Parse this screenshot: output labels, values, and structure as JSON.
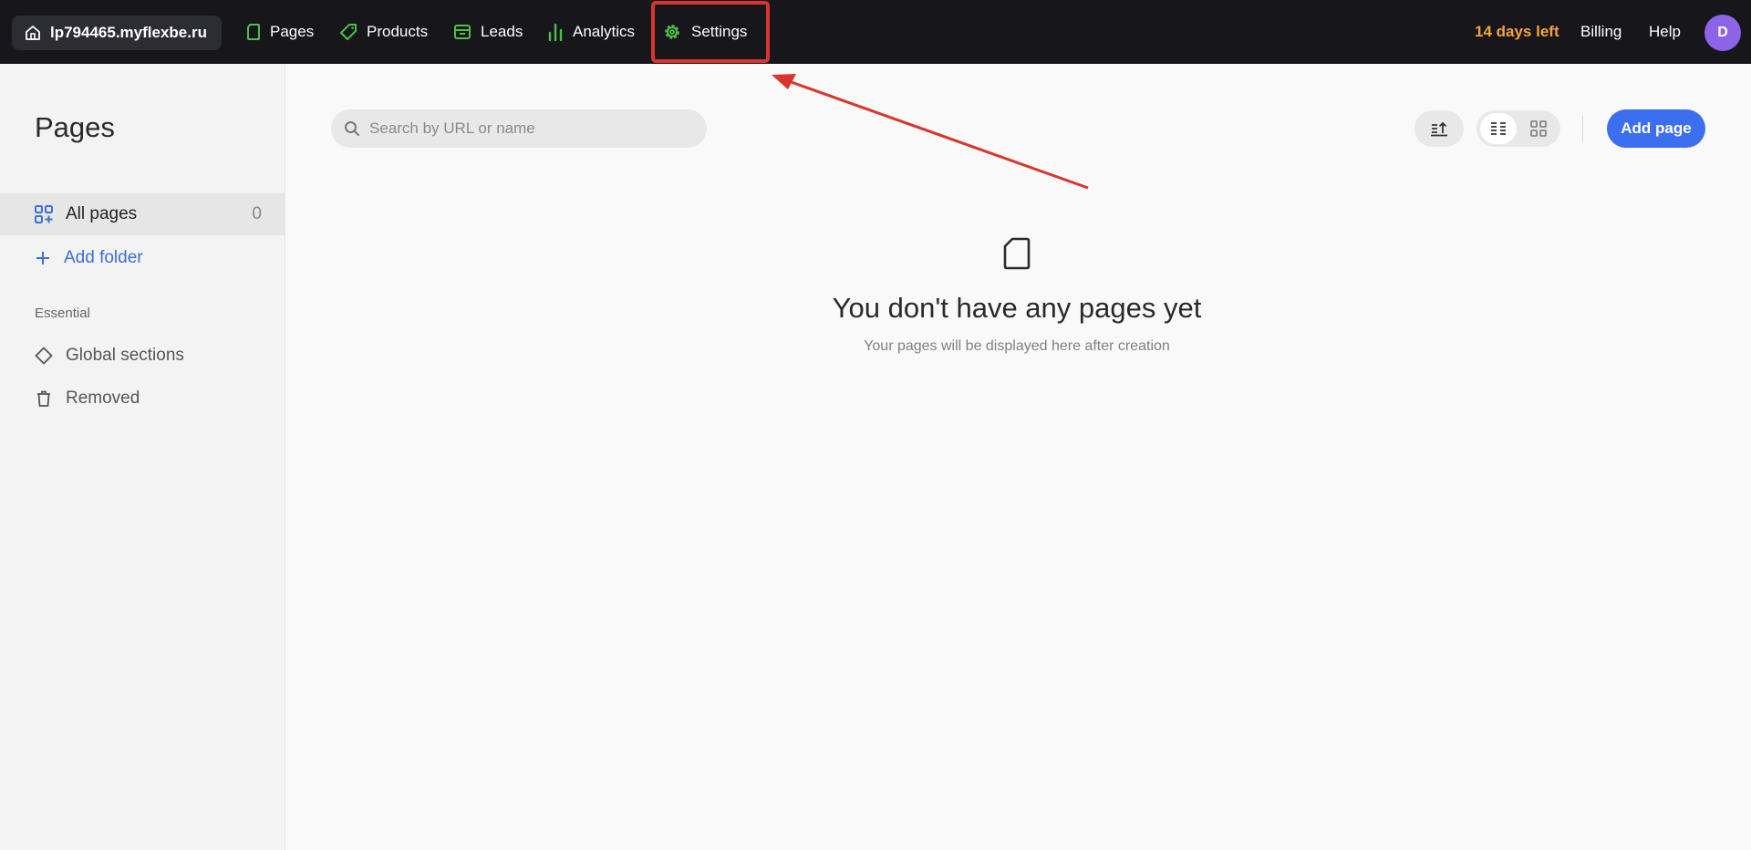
{
  "topbar": {
    "site": "lp794465.myflexbe.ru",
    "nav": [
      {
        "label": "Pages",
        "icon": "page-icon",
        "color": "#4fbf4a"
      },
      {
        "label": "Products",
        "icon": "tag-icon",
        "color": "#4fbf4a"
      },
      {
        "label": "Leads",
        "icon": "inbox-icon",
        "color": "#4fbf4a"
      },
      {
        "label": "Analytics",
        "icon": "bar-chart-icon",
        "color": "#4fbf4a"
      },
      {
        "label": "Settings",
        "icon": "gear-icon",
        "color": "#4fbf4a"
      }
    ],
    "trial": "14 days left",
    "billing": "Billing",
    "help": "Help",
    "avatar_initial": "D",
    "avatar_color": "#8d63e8"
  },
  "sidebar": {
    "title": "Pages",
    "all_pages": {
      "label": "All pages",
      "count": "0"
    },
    "add_folder": "Add folder",
    "section_label": "Essential",
    "global_sections": "Global sections",
    "removed": "Removed"
  },
  "main": {
    "search_placeholder": "Search by URL or name",
    "add_page": "Add page",
    "empty_title": "You don't have any pages yet",
    "empty_subtitle": "Your pages will be displayed here after creation"
  },
  "colors": {
    "accent": "#3c6ef0",
    "highlight": "#d8362c",
    "trial": "#f7a23b"
  }
}
